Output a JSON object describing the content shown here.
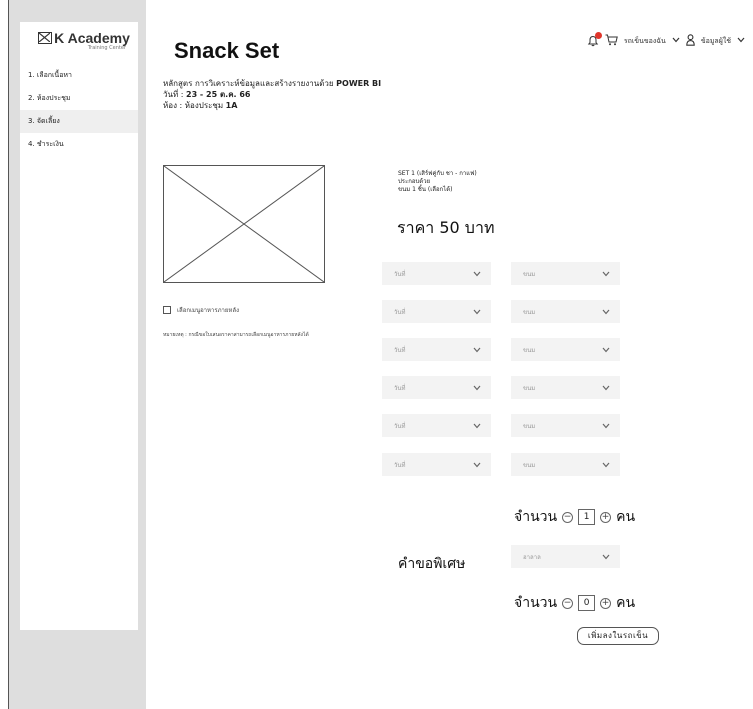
{
  "logo": {
    "title": "K Academy",
    "subtitle": "Training Center"
  },
  "sidebar": {
    "steps": [
      {
        "label": "1. เลือกเนื้อหา"
      },
      {
        "label": "2. ห้องประชุม"
      },
      {
        "label": "3. จัดเลี้ยง"
      },
      {
        "label": "4. ชำระเงิน"
      }
    ]
  },
  "header": {
    "page_title": "Snack Set",
    "cart_label": "รถเข็นของฉัน",
    "profile_label": "ข้อมูลผู้ใช้"
  },
  "course": {
    "line1_prefix": "หลักสูตร การวิเคราะห์ข้อมูลและสร้างรายงานด้วย ",
    "line1_bold": "POWER BI",
    "date_prefix": "วันที่ : ",
    "date_value": "23 - 25 ต.ค. 66",
    "room_prefix": "ห้อง : ห้องประชุม ",
    "room_value": "1A"
  },
  "set": {
    "name": "SET 1 (เสิร์ฟคู่กับ ชา - กาแฟ)",
    "includes": "ประกอบด้วย",
    "item": "ขนม 1 ชิ้น (เลือกได้)",
    "price": "ราคา 50 บาท"
  },
  "options": {
    "later_menu_label": "เลือกเมนูอาหารภายหลัง",
    "note": "หมายเหตุ : กรณีขอใบเสนอราคาสามารถเลือกเมนูอาหารภายหลังได้"
  },
  "selects": {
    "rows": [
      {
        "day": "วันที่",
        "snack": "ขนม"
      },
      {
        "day": "วันที่",
        "snack": "ขนม"
      },
      {
        "day": "วันที่",
        "snack": "ขนม"
      },
      {
        "day": "วันที่",
        "snack": "ขนม"
      },
      {
        "day": "วันที่",
        "snack": "ขนม"
      },
      {
        "day": "วันที่",
        "snack": "ขนม"
      }
    ],
    "special_value": "ฮาลาล"
  },
  "quantity": {
    "label": "จำนวน",
    "unit": "คน",
    "regular_value": "1",
    "special_value": "0",
    "minus": "⊖",
    "plus": "⊕"
  },
  "special": {
    "label": "คำขอพิเศษ"
  },
  "add_to_cart": "เพิ่มลงในรถเข็น",
  "colors": {
    "notification": "#e0352b",
    "sidebar_bg": "#dedede",
    "select_bg": "#f3f3f3"
  }
}
